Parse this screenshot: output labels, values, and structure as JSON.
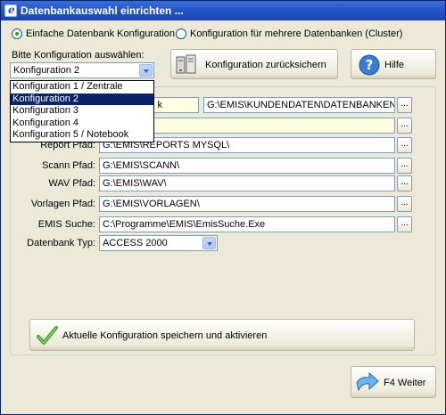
{
  "window": {
    "title": "Datenbankauswahl einrichten ..."
  },
  "mode": {
    "option_single": "Einfache Datenbank Konfiguration",
    "option_cluster": "Konfiguration für mehrere Datenbanken (Cluster)",
    "selected": "single"
  },
  "config_select": {
    "label": "Bitte Konfiguration auswählen:",
    "value": "Konfiguration 2",
    "options": [
      "Konfiguration 1 / Zentrale",
      "Konfiguration 2",
      "Konfiguration 3",
      "Konfiguration 4",
      "Konfiguration 5 / Notebook"
    ],
    "highlighted_index": 1
  },
  "buttons": {
    "reset_label": "Konfiguration zurücksichern",
    "help_label": "Hilfe",
    "save_label": "Aktuelle Konfiguration speichern und aktivieren",
    "next_label": "F4 Weiter"
  },
  "fields": {
    "row1_partial": "k",
    "row1_path": "G:\\EMIS\\KUNDENDATEN\\DATENBANKEN\\E",
    "report": {
      "label": "Report Pfad:",
      "value": "G:\\EMIS\\REPORTS MYSQL\\"
    },
    "scan": {
      "label": "Scann Pfad:",
      "value": "G:\\EMIS\\SCANN\\"
    },
    "wav": {
      "label": "WAV Pfad:",
      "value": "G:\\EMIS\\WAV\\"
    },
    "templates": {
      "label": "Vorlagen Pfad:",
      "value": "G:\\EMIS\\VORLAGEN\\"
    },
    "search": {
      "label": "EMIS Suche:",
      "value": "C:\\Programme\\EMIS\\EmisSuche.Exe"
    },
    "dbtype": {
      "label": "Datenbank Typ:",
      "value": "ACCESS 2000"
    },
    "browse_label": "..."
  },
  "colors": {
    "titlebar": "#2456c6",
    "selection": "#0a246a",
    "field_yellow": "#ffffe1",
    "window": "#ece9d8"
  }
}
